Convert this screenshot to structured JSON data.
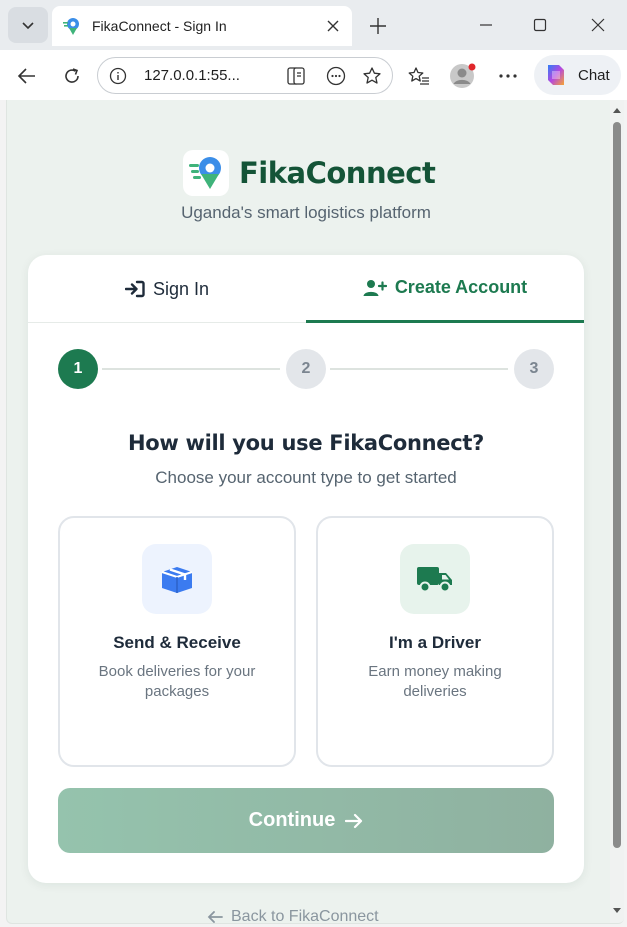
{
  "browser": {
    "tab_title": "FikaConnect - Sign In",
    "address": "127.0.0.1:55...",
    "copilot_label": "Chat"
  },
  "page": {
    "brand_name": "FikaConnect",
    "tagline": "Uganda's smart logistics platform",
    "tabs": {
      "signin": "Sign In",
      "create": "Create Account",
      "active": "create"
    },
    "steps": [
      "1",
      "2",
      "3"
    ],
    "current_step": 1,
    "question": "How will you use FikaConnect?",
    "subquestion": "Choose your account type to get started",
    "options": [
      {
        "title": "Send & Receive",
        "desc": "Book deliveries for your packages",
        "icon": "box-icon"
      },
      {
        "title": "I'm a Driver",
        "desc": "Earn money making deliveries",
        "icon": "truck-icon"
      }
    ],
    "continue_label": "Continue",
    "back_link": "Back to FikaConnect"
  },
  "colors": {
    "brand_green": "#1d7a50",
    "brand_dark": "#145437",
    "page_bg": "#ecf2ee",
    "send_icon_bg": "#edf3fe",
    "send_icon": "#3b7bf0",
    "driver_icon_bg": "#e7f3ec",
    "driver_icon": "#1d7a50"
  }
}
